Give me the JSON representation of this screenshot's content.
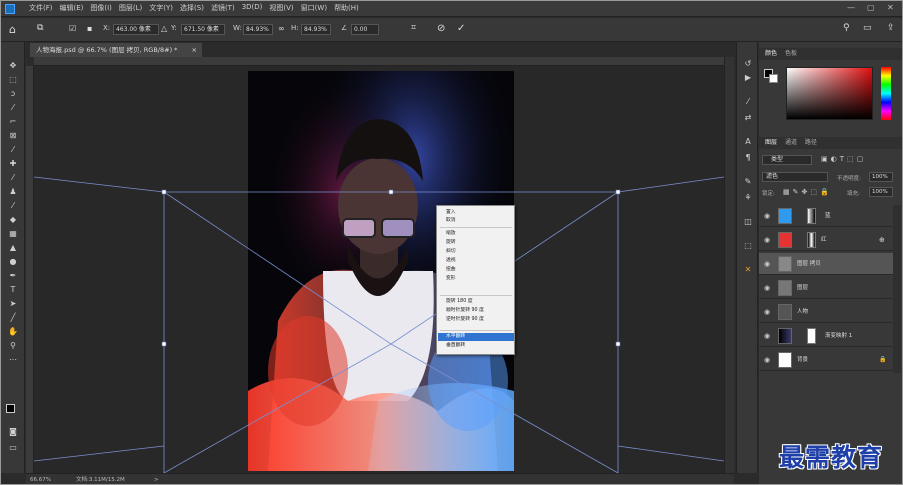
{
  "menubar": {
    "items": [
      "文件(F)",
      "编辑(E)",
      "图像(I)",
      "图层(L)",
      "文字(Y)",
      "选择(S)",
      "滤镜(T)",
      "3D(D)",
      "视图(V)",
      "窗口(W)",
      "帮助(H)"
    ],
    "minimize": "—",
    "restore": "▢",
    "close": "✕"
  },
  "options": {
    "x_label": "X:",
    "x_value": "463.00 像素",
    "y_label": "Y:",
    "y_value": "671.50 像素",
    "w_label": "W:",
    "w_value": "84.93%",
    "h_label": "H:",
    "h_value": "84.93%",
    "angle_label": "∠",
    "angle_value": "0.00",
    "icons": {
      "home": "home-icon",
      "transform": "transform-icon",
      "link": "link-icon",
      "warp": "warp-icon",
      "cancel": "cancel-icon",
      "commit": "commit-icon",
      "search": "search-icon",
      "workspace": "workspace-icon",
      "share": "share-icon"
    }
  },
  "document": {
    "tab_title": "人物海报.psd @ 66.7% (图层 拷贝, RGB/8#) *",
    "tab_close": "×"
  },
  "status": {
    "zoom": "66.67%",
    "doc": "文档:3.11M/15.2M",
    "arrow": ">"
  },
  "context_menu": {
    "items": [
      "置入",
      "取消",
      "缩放",
      "旋转",
      "斜切",
      "透视",
      "扭曲",
      "变形",
      "旋转 180 度",
      "顺时针旋转 90 度",
      "逆时针旋转 90 度",
      "水平翻转",
      "垂直翻转"
    ],
    "highlighted": "水平翻转"
  },
  "panels": {
    "color_tabs": [
      "颜色",
      "色板"
    ],
    "layer_tabs": [
      "图层",
      "通道",
      "路径"
    ],
    "kind_filter": "类型",
    "blend_mode": "滤色",
    "opacity_label": "不透明度:",
    "opacity_value": "100%",
    "lock_label": "锁定:",
    "fill_label": "填充:",
    "fill_value": "100%",
    "layers": [
      {
        "name": "蓝",
        "thumb": "#2f9bf0",
        "selected": false
      },
      {
        "name": "红",
        "thumb": "#e53333",
        "selected": false
      },
      {
        "name": "图层 拷贝",
        "thumb": "#888888",
        "selected": true
      },
      {
        "name": "图层",
        "thumb": "#777777",
        "selected": false
      },
      {
        "name": "人物",
        "thumb": "#555555",
        "selected": false
      },
      {
        "name": "渐变映射 1",
        "thumb": "#3a3a3a",
        "selected": false
      },
      {
        "name": "背景",
        "thumb": "#ffffff",
        "selected": false
      }
    ]
  },
  "watermark": "最需教育",
  "colors": {
    "foreground": "#000000",
    "background": "#ffffff",
    "accent": "#2f74d0"
  }
}
